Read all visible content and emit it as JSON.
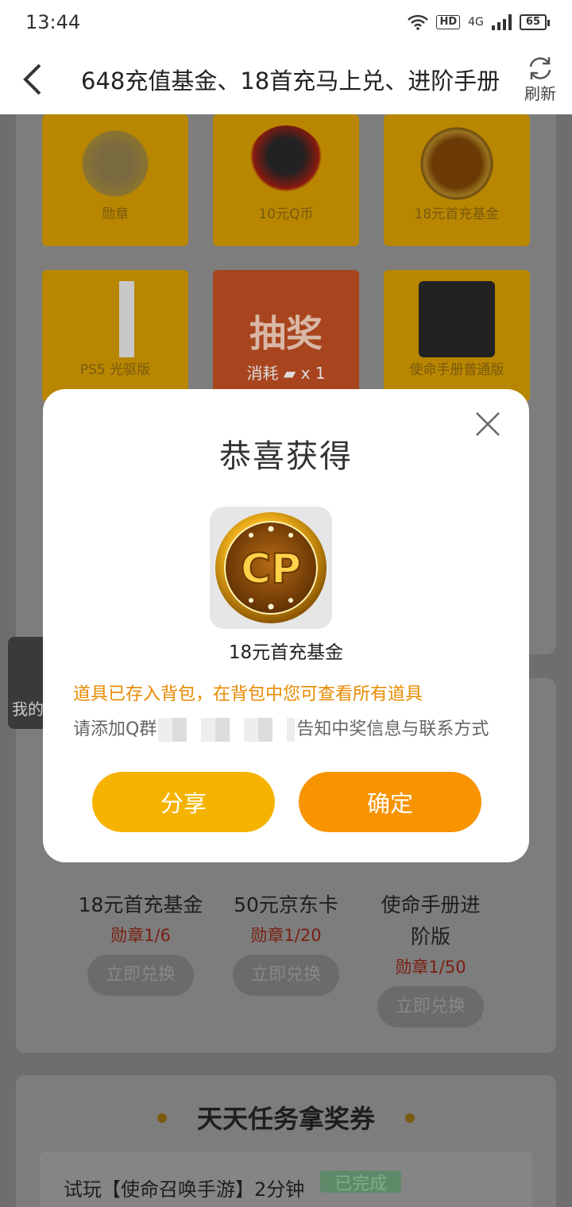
{
  "status": {
    "time": "13:44",
    "network": "4G",
    "hd": "HD",
    "battery": "65"
  },
  "header": {
    "title": "648充值基金、18首充马上兑、进阶手册",
    "refresh_label": "刷新"
  },
  "prizes": [
    {
      "label": "勋章",
      "icon": "medal-icon"
    },
    {
      "label": "10元Q币",
      "icon": "qq-penguin-icon"
    },
    {
      "label": "18元首充基金",
      "icon": "cp-coin-icon"
    },
    {
      "label": "PS5 光驱版",
      "icon": "ps5-console-icon"
    },
    {
      "label": "抽奖",
      "cost": "消耗",
      "cost_count": "x 1",
      "icon": "lottery-icon"
    },
    {
      "label": "使命手册普通版",
      "icon": "gun-icon"
    }
  ],
  "side_tab": {
    "label": "我的"
  },
  "exchange": {
    "items": [
      {
        "name": "18元首充基金",
        "cost": "勋章1/6",
        "button": "立即兑换"
      },
      {
        "name": "50元京东卡",
        "cost": "勋章1/20",
        "button": "立即兑换"
      },
      {
        "name": "使命手册进阶版",
        "cost": "勋章1/50",
        "button": "立即兑换"
      }
    ]
  },
  "tasks": {
    "title": "天天任务拿奖券",
    "rows": [
      {
        "label": "试玩【使命召唤手游】2分钟",
        "status": "已完成"
      }
    ]
  },
  "modal": {
    "title": "恭喜获得",
    "prize_name": "18元首充基金",
    "notice": "道具已存入背包，在背包中您可查看所有道具",
    "contact_prefix": "请添加Q群",
    "contact_suffix": "告知中奖信息与联系方式",
    "share_label": "分享",
    "confirm_label": "确定"
  },
  "colors": {
    "orange": "#f79400",
    "yellow": "#f5b300",
    "notice": "#e88a00"
  }
}
